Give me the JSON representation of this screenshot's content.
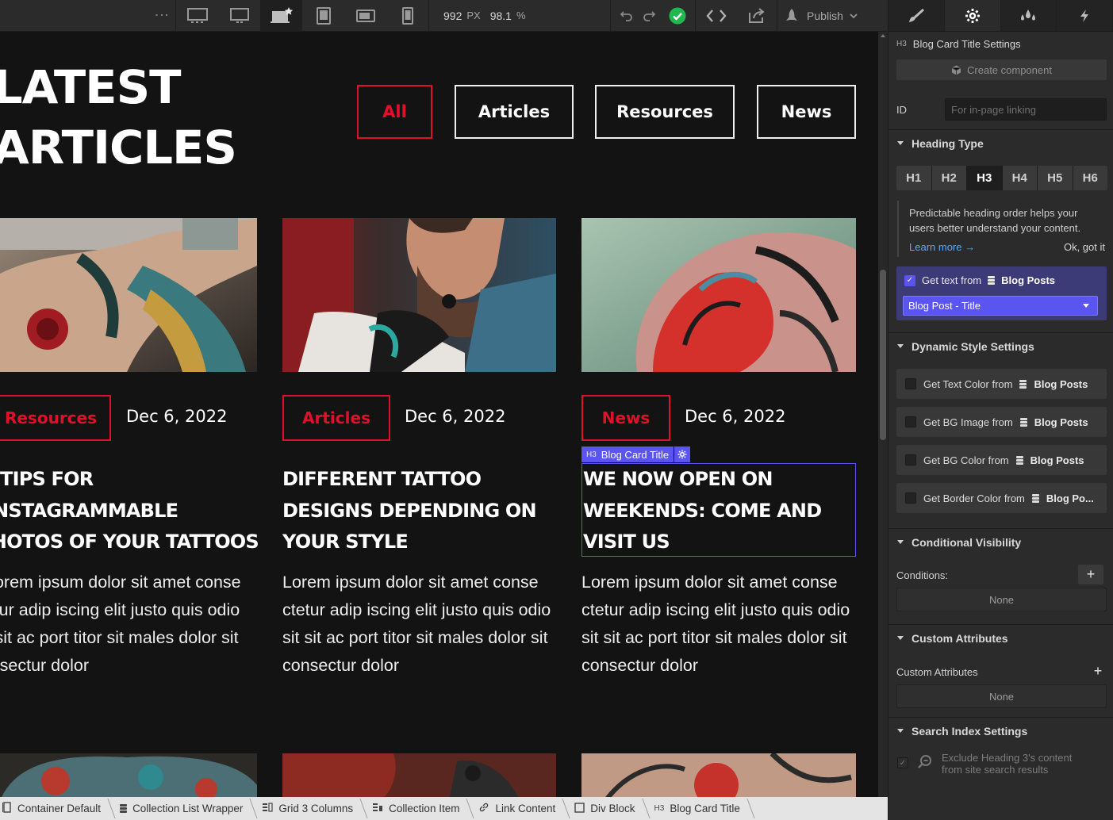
{
  "toolbar": {
    "dots": "⋮",
    "breakpoints": [
      "desktop-xl",
      "desktop-large",
      "desktop-base",
      "tablet",
      "mobile-landscape",
      "mobile-portrait"
    ],
    "width_value": "992",
    "width_unit": "PX",
    "zoom_value": "98.1",
    "zoom_unit": "%",
    "publish_label": "Publish"
  },
  "page": {
    "title_line1": "LATEST",
    "title_line2": "ARTICLES",
    "filters": [
      "All",
      "Articles",
      "Resources",
      "News"
    ],
    "active_filter": "All",
    "accent_color": "#e0102a",
    "cards": [
      {
        "tag": "Resources",
        "date": "Dec 6, 2022",
        "title": "TIPS FOR INSTAGRAMMABLE PHOTOS OF YOUR TATTOOS",
        "title_lines": [
          "TIPS FOR",
          "INSTAGRAMMABLE",
          "PHOTOS OF YOUR TATTOOS"
        ],
        "body_lines": [
          "Lorem ipsum dolor sit amet conse",
          "ctetur adip iscing elit justo quis odio",
          "sit sit ac port titor sit males dolor sit",
          "consectur dolor"
        ]
      },
      {
        "tag": "Articles",
        "date": "Dec 6, 2022",
        "title": "DIFFERENT TATTOO DESIGNS DEPENDING ON YOUR STYLE",
        "title_lines": [
          "DIFFERENT TATTOO",
          "DESIGNS DEPENDING ON",
          "YOUR STYLE"
        ],
        "body_lines": [
          "Lorem ipsum dolor sit amet conse",
          "ctetur adip iscing elit justo quis odio",
          "sit sit ac port titor sit males dolor sit",
          "consectur dolor"
        ]
      },
      {
        "tag": "News",
        "date": "Dec 6, 2022",
        "title": "WE NOW OPEN ON WEEKENDS: COME AND VISIT US",
        "title_lines": [
          "WE NOW OPEN ON",
          "WEEKENDS: COME AND",
          "VISIT US"
        ],
        "body_lines": [
          "Lorem ipsum dolor sit amet conse",
          "ctetur adip iscing elit justo quis odio",
          "sit sit ac port titor sit males dolor sit",
          "consectur dolor"
        ]
      }
    ],
    "selection_badge": "Blog Card Title",
    "selection_tag": "H3",
    "selection_color": "#5a54f0"
  },
  "breadcrumbs": [
    {
      "icon": "container-icon",
      "label": "Container Default"
    },
    {
      "icon": "collection-list-icon",
      "label": "Collection List Wrapper"
    },
    {
      "icon": "grid-icon",
      "label": "Grid 3 Columns"
    },
    {
      "icon": "collection-item-icon",
      "label": "Collection Item"
    },
    {
      "icon": "link-icon",
      "label": "Link Content"
    },
    {
      "icon": "div-block-icon",
      "label": "Div Block"
    },
    {
      "icon": "heading-icon",
      "label": "Blog Card Title",
      "tag": "H3"
    }
  ],
  "panel": {
    "tabs": [
      "style-brush",
      "settings-gear",
      "interactions-drops",
      "lightning"
    ],
    "element_tag": "H3",
    "element_title": "Blog Card Title Settings",
    "create_component": "Create component",
    "id_label": "ID",
    "id_placeholder": "For in-page linking",
    "heading_type": {
      "title": "Heading Type",
      "options": [
        "H1",
        "H2",
        "H3",
        "H4",
        "H5",
        "H6"
      ],
      "selected": "H3"
    },
    "tip": {
      "line1": "Predictable heading order helps your",
      "line2": "users better understand your content.",
      "learn_more": "Learn more →",
      "ok": "Ok, got it"
    },
    "get_text": {
      "checked": true,
      "label": "Get text from",
      "source": "Blog Posts",
      "field": "Blog Post - Title"
    },
    "dynamic_style": {
      "title": "Dynamic Style Settings",
      "items": [
        {
          "label": "Get Text Color from",
          "source": "Blog Posts"
        },
        {
          "label": "Get BG Image from",
          "source": "Blog Posts"
        },
        {
          "label": "Get BG Color from",
          "source": "Blog Posts"
        },
        {
          "label": "Get Border Color from",
          "source": "Blog Po..."
        }
      ]
    },
    "conditional_visibility": {
      "title": "Conditional Visibility",
      "conditions_label": "Conditions:",
      "add": "+",
      "value": "None"
    },
    "custom_attributes": {
      "title": "Custom Attributes",
      "label": "Custom Attributes",
      "add": "+",
      "value": "None"
    },
    "search_index": {
      "title": "Search Index Settings",
      "line1": "Exclude Heading 3's content",
      "line2": "from site search results"
    }
  }
}
